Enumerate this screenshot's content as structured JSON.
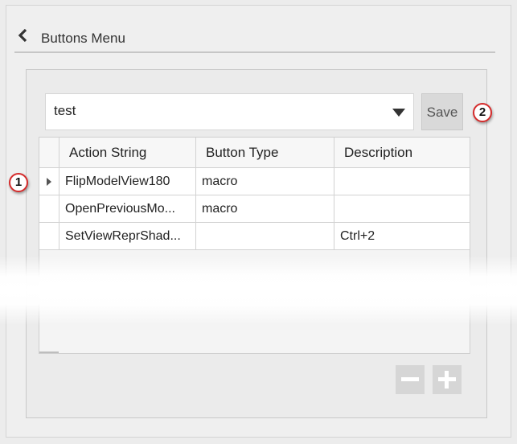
{
  "header": {
    "title": "Buttons Menu",
    "back_icon": "chevron-left-icon"
  },
  "toolbar": {
    "select_value": "test",
    "save_label": "Save"
  },
  "callouts": {
    "one": "1",
    "two": "2"
  },
  "grid": {
    "columns": [
      "Action String",
      "Button Type",
      "Description"
    ],
    "rows": [
      {
        "action": "FlipModelView180",
        "type": "macro",
        "description": ""
      },
      {
        "action": "OpenPreviousMo...",
        "type": "macro",
        "description": ""
      },
      {
        "action": "SetViewReprShad...",
        "type": "",
        "description": "Ctrl+2"
      }
    ]
  },
  "actions": {
    "remove_icon": "minus-icon",
    "add_icon": "plus-icon"
  },
  "colors": {
    "callout_border": "#d52b2b",
    "button_bg": "#d6d6d6"
  }
}
